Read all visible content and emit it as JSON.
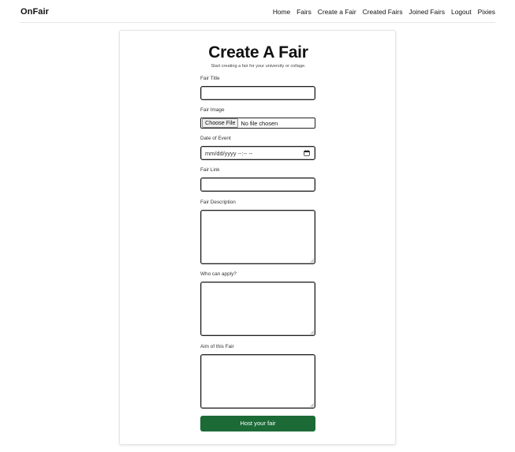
{
  "brand": "OnFair",
  "nav": [
    "Home",
    "Fairs",
    "Create a Fair",
    "Created Fairs",
    "Joined Fairs",
    "Logout",
    "Pixies"
  ],
  "form": {
    "title": "Create A Fair",
    "subtitle": "Start creating a fair for your university or collage.",
    "fair_title_label": "Fair Title",
    "fair_image_label": "Fair Image",
    "choose_file": "Choose File",
    "no_file": "No file chosen",
    "date_label": "Date of Event",
    "date_placeholder": "mm/dd/yyyy --:-- --",
    "link_label": "Fair Link",
    "description_label": "Fair Description",
    "who_label": "Who can apply?",
    "aim_label": "Aim of this Fair",
    "submit": "Host your fair"
  },
  "colors": {
    "accent": "#1c6b37",
    "text": "#111111"
  },
  "icons": {
    "date_picker": "calendar-icon",
    "textarea_handle": "resize-grip-icon"
  }
}
